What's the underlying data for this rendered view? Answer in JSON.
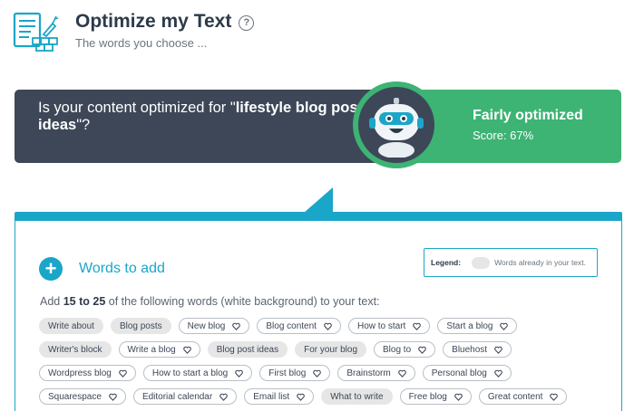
{
  "header": {
    "title": "Optimize my Text",
    "subtitle": "The words you choose ...",
    "help_glyph": "?"
  },
  "banner": {
    "question_prefix": "Is your content optimized for \"",
    "keyword": "lifestyle blog post ideas",
    "question_suffix": "\"?",
    "status": "Fairly optimized",
    "score": "Score: 67%",
    "colors": {
      "dark": "#3d4757",
      "green": "#3db374"
    }
  },
  "words_panel": {
    "title": "Words to add",
    "add_glyph": "+",
    "legend_label": "Legend:",
    "legend_text": "Words already in your text.",
    "instructions_prefix": "Add ",
    "instructions_range": "15 to 25",
    "instructions_suffix": " of the following words (white background) to your text:",
    "accent": "#1aa6c8",
    "rows": [
      [
        {
          "text": "Write about",
          "used": true
        },
        {
          "text": "Blog posts",
          "used": true
        },
        {
          "text": "New blog",
          "used": false
        },
        {
          "text": "Blog content",
          "used": false
        },
        {
          "text": "How to start",
          "used": false
        },
        {
          "text": "Start a blog",
          "used": false
        }
      ],
      [
        {
          "text": "Writer's block",
          "used": true
        },
        {
          "text": "Write a blog",
          "used": false
        },
        {
          "text": "Blog post ideas",
          "used": true
        },
        {
          "text": "For your blog",
          "used": true
        },
        {
          "text": "Blog to",
          "used": false
        },
        {
          "text": "Bluehost",
          "used": false
        }
      ],
      [
        {
          "text": "Wordpress blog",
          "used": false
        },
        {
          "text": "How to start a blog",
          "used": false
        },
        {
          "text": "First blog",
          "used": false
        },
        {
          "text": "Brainstorm",
          "used": false
        },
        {
          "text": "Personal blog",
          "used": false
        }
      ],
      [
        {
          "text": "Squarespace",
          "used": false
        },
        {
          "text": "Editorial calendar",
          "used": false
        },
        {
          "text": "Email list",
          "used": false
        },
        {
          "text": "What to write",
          "used": true
        },
        {
          "text": "Free blog",
          "used": false
        },
        {
          "text": "Great content",
          "used": false
        }
      ]
    ]
  }
}
